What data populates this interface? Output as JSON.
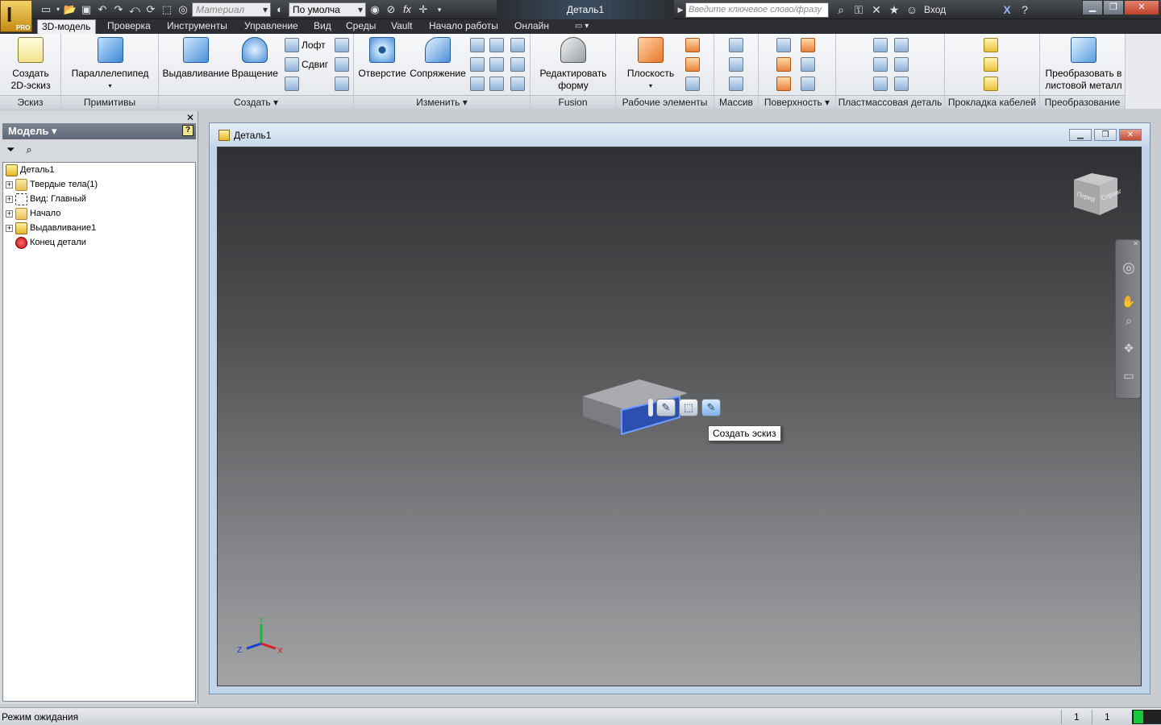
{
  "window": {
    "document_title": "Деталь1",
    "brand_badge": "PRO",
    "search_placeholder": "Введите ключевое слово/фразу",
    "login_label": "Вход"
  },
  "qat": {
    "material_placeholder": "Материал",
    "appearance_value": "По умолча"
  },
  "tabs": [
    {
      "label": "3D-модель",
      "active": true
    },
    {
      "label": "Проверка"
    },
    {
      "label": "Инструменты"
    },
    {
      "label": "Управление"
    },
    {
      "label": "Вид"
    },
    {
      "label": "Среды"
    },
    {
      "label": "Vault"
    },
    {
      "label": "Начало работы"
    },
    {
      "label": "Онлайн"
    }
  ],
  "ribbon": {
    "panels": {
      "sketch": "Эскиз",
      "primitives": "Примитивы",
      "create": "Создать ▾",
      "modify": "Изменить ▾",
      "fusion": "Fusion",
      "work_features": "Рабочие элементы",
      "pattern": "Массив",
      "surface": "Поверхность ▾",
      "plastic": "Пластмассовая деталь",
      "harness": "Прокладка кабелей",
      "convert": "Преобразование"
    },
    "buttons": {
      "create_sketch": "Создать\n2D-эскиз",
      "box": "Параллелепипед",
      "extrude": "Выдавливание",
      "revolve": "Вращение",
      "loft": "Лофт",
      "sweep": "Сдвиг",
      "hole": "Отверстие",
      "fillet": "Сопряжение",
      "edit_form": "Редактировать\nформу",
      "plane": "Плоскость",
      "to_sheet_metal": "Преобразовать в\nлистовой металл"
    }
  },
  "browser": {
    "title": "Модель ▾",
    "tree": [
      {
        "label": "Деталь1",
        "icon": "part-icon",
        "indent": 0,
        "expandable": false
      },
      {
        "label": "Твердые тела(1)",
        "icon": "solid-bodies-icon",
        "indent": 1,
        "expandable": true
      },
      {
        "label": "Вид: Главный",
        "icon": "view-icon",
        "indent": 1,
        "expandable": true
      },
      {
        "label": "Начало",
        "icon": "folder-icon",
        "indent": 1,
        "expandable": true
      },
      {
        "label": "Выдавливание1",
        "icon": "extrusion-icon",
        "indent": 1,
        "expandable": true
      },
      {
        "label": "Конец детали",
        "icon": "end-of-part-icon",
        "indent": 1,
        "expandable": false
      }
    ]
  },
  "viewport": {
    "tooltip": "Создать эскиз",
    "viewcube_front": "Перед",
    "viewcube_right": "Справа",
    "triad": {
      "x": "X",
      "y": "Y",
      "z": "Z"
    }
  },
  "status": {
    "text": "Режим ожидания",
    "count1": "1",
    "count2": "1"
  },
  "colors": {
    "accent_selection": "#4a7fe0",
    "status_ok": "#19c83a"
  }
}
